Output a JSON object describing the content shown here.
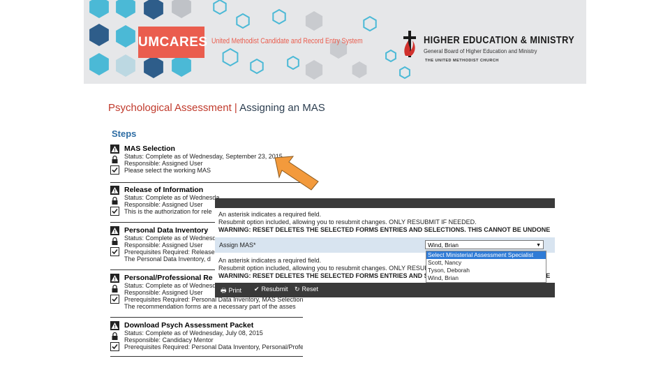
{
  "banner": {
    "logo": "UMCARES",
    "logo_subtitle": "United Methodist Candidate and Record Entry System",
    "org_title": "HIGHER EDUCATION & MINISTRY",
    "org_subtitle": "General Board of Higher Education and Ministry",
    "org_church": "THE UNITED METHODIST CHURCH",
    "colors": {
      "accent": "#ea5d4e",
      "hex_teal": "#4bb9d6",
      "hex_navy": "#2e5d8a"
    }
  },
  "slide": {
    "title_part1": "Psychological Assessment | ",
    "title_part2": "Assigning an MAS"
  },
  "steps": {
    "heading": "Steps",
    "items": [
      {
        "name": "MAS Selection",
        "lines": [
          "Status: Complete as of Wednesday, September 23, 2015",
          "Responsible: Assigned User",
          "Please select the working MAS"
        ]
      },
      {
        "name": "Release of Information",
        "lines": [
          "Status: Complete as of Wednesda",
          "Responsible: Assigned User",
          "This is the authorization for rele"
        ]
      },
      {
        "name": "Personal Data Inventory",
        "lines": [
          "Status: Complete as of Wednesda",
          "Responsible: Assigned User",
          "Prerequisites Required: Release o",
          "The Personal Data Inventory, d"
        ]
      },
      {
        "name": "Personal/Professional Re",
        "lines": [
          "Status: Complete as of Wednesda",
          "Responsible: Assigned User",
          "Prerequisites Required: Personal Data Inventory, MAS Selection",
          "The recommendation forms are a necessary part of the asses"
        ]
      },
      {
        "name": "Download Psych Assessment Packet",
        "lines": [
          "Status: Complete as of Wednesday, July 08, 2015",
          "Responsible: Candidacy Mentor",
          "Prerequisites Required: Personal Data Inventory, Personal/Professi"
        ]
      }
    ]
  },
  "modal": {
    "note1": "An asterisk indicates a required field.",
    "note2": "Resubmit option included, allowing you to resubmit changes. ONLY RESUBMIT IF NEEDED.",
    "warning": "WARNING: RESET DELETES THE SELECTED FORMS ENTRIES AND SELECTIONS. THIS CANNOT BE UNDONE",
    "assign_label": "Assign MAS*",
    "selected_value": "Wind, Brian",
    "options": [
      "Select Ministerial Assessment Specialist",
      "Scott, Nancy",
      "Tyson, Deborah",
      "Wind, Brian"
    ],
    "note1_b": "An asterisk indicates a required field.",
    "note2_b": "Resubmit option included, allowing you to resubmit changes. ONLY RESUBMIT IF NEEDED.",
    "warning_b": "WARNING: RESET DELETES THE SELECTED FORMS ENTRIES AND SELECTIONS. THIS CANNOT BE UNDONE",
    "buttons": {
      "print": "Print",
      "resubmit": "Resubmit",
      "reset": "Reset"
    }
  }
}
